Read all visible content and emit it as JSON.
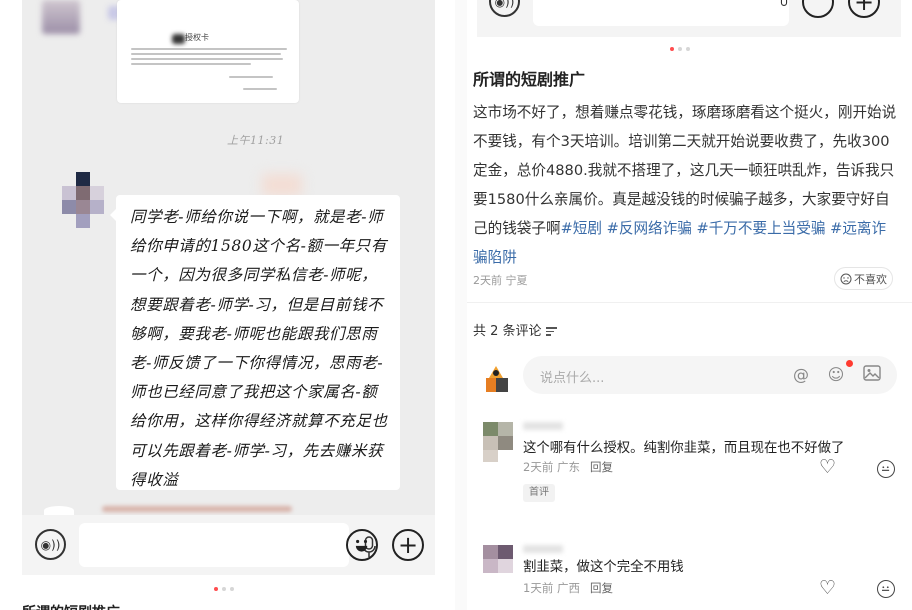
{
  "left": {
    "card_title": "授权卡",
    "timestamp": "上午11:31",
    "message": "同学老-师给你说一下啊，就是老-师给你申请的1580这个名-额一年只有一个，因为很多同学私信老-师呢，想要跟着老-师学-习，但是目前钱不够啊，要我老-师呢也能跟我们思雨老-师反馈了一下你得情况，思雨老-师也已经同意了我把这个家属名-额给你用，这样你得经济就算不充足也可以先跟着老-师学-习，先去赚米获得收溢",
    "icons": [
      "voice-icon",
      "mic-icon",
      "emoji-icon",
      "plus-icon"
    ]
  },
  "right": {
    "post_title": "所谓的短剧推广",
    "post_body": "这市场不好了，想着赚点零花钱，琢磨琢磨看这个挺火，刚开始说不要钱，有个3天培训。培训第二天就开始说要收费了，先收300定金，总价4880.我就不搭理了，这几天一顿狂哄乱炸，告诉我只要1580什么亲属价。真是越没钱的时候骗子越多，大家要守好自己的钱袋子啊",
    "tags": [
      "#短剧",
      "#反网络诈骗",
      "#千万不要上当受骗",
      "#远离诈骗陷阱"
    ],
    "post_meta": "2天前 宁夏",
    "dislike_label": "不喜欢",
    "comment_count": "共 2 条评论",
    "comment_placeholder": "说点什么...",
    "comments": [
      {
        "text": "这个哪有什么授权。纯割你韭菜，而且现在也不好做了",
        "meta": "2天前 广东",
        "reply": "回复",
        "badge": "首评"
      },
      {
        "text": "割韭菜，做这个完全不用钱",
        "meta": "1天前 广西",
        "reply": "回复"
      }
    ]
  },
  "colors": {
    "accent": "#ff4d4f",
    "tag": "#3a6ba8",
    "chat_bg": "#ededed"
  }
}
